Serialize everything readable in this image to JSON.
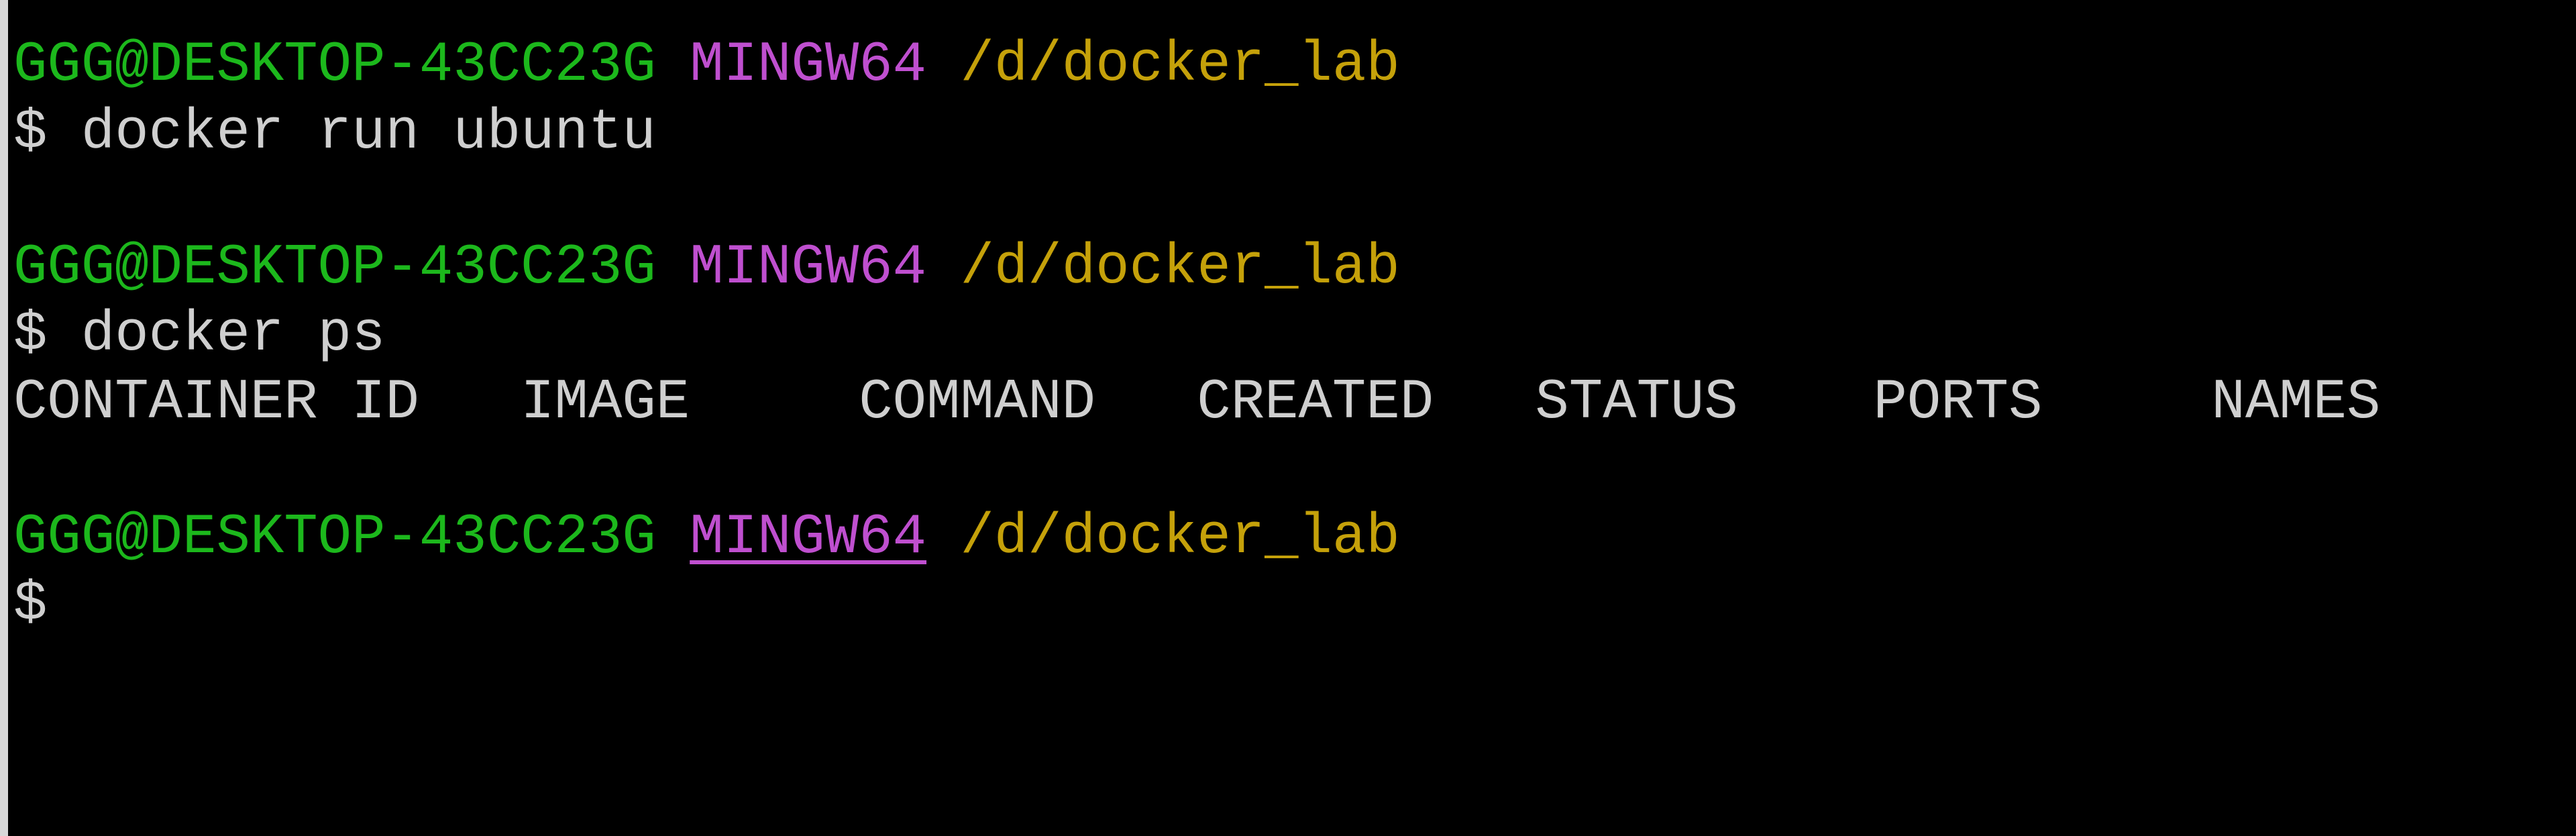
{
  "terminal": {
    "colors": {
      "user": "#1cb81c",
      "env": "#bf4fcf",
      "path": "#c5a10a",
      "text": "#cfcfcf",
      "background": "#000000"
    },
    "blocks": [
      {
        "prompt": {
          "user_host": "GGG@DESKTOP-43CC23G",
          "env": "MINGW64",
          "path": "/d/docker_lab"
        },
        "command": "$ docker run ubuntu",
        "output": []
      },
      {
        "prompt": {
          "user_host": "GGG@DESKTOP-43CC23G",
          "env": "MINGW64",
          "path": "/d/docker_lab"
        },
        "command": "$ docker ps",
        "output": [
          "CONTAINER ID   IMAGE     COMMAND   CREATED   STATUS    PORTS     NAMES"
        ]
      },
      {
        "prompt": {
          "user_host": "GGG@DESKTOP-43CC23G",
          "env": "MINGW64",
          "path": "/d/docker_lab"
        },
        "command": "$",
        "output": []
      }
    ]
  }
}
